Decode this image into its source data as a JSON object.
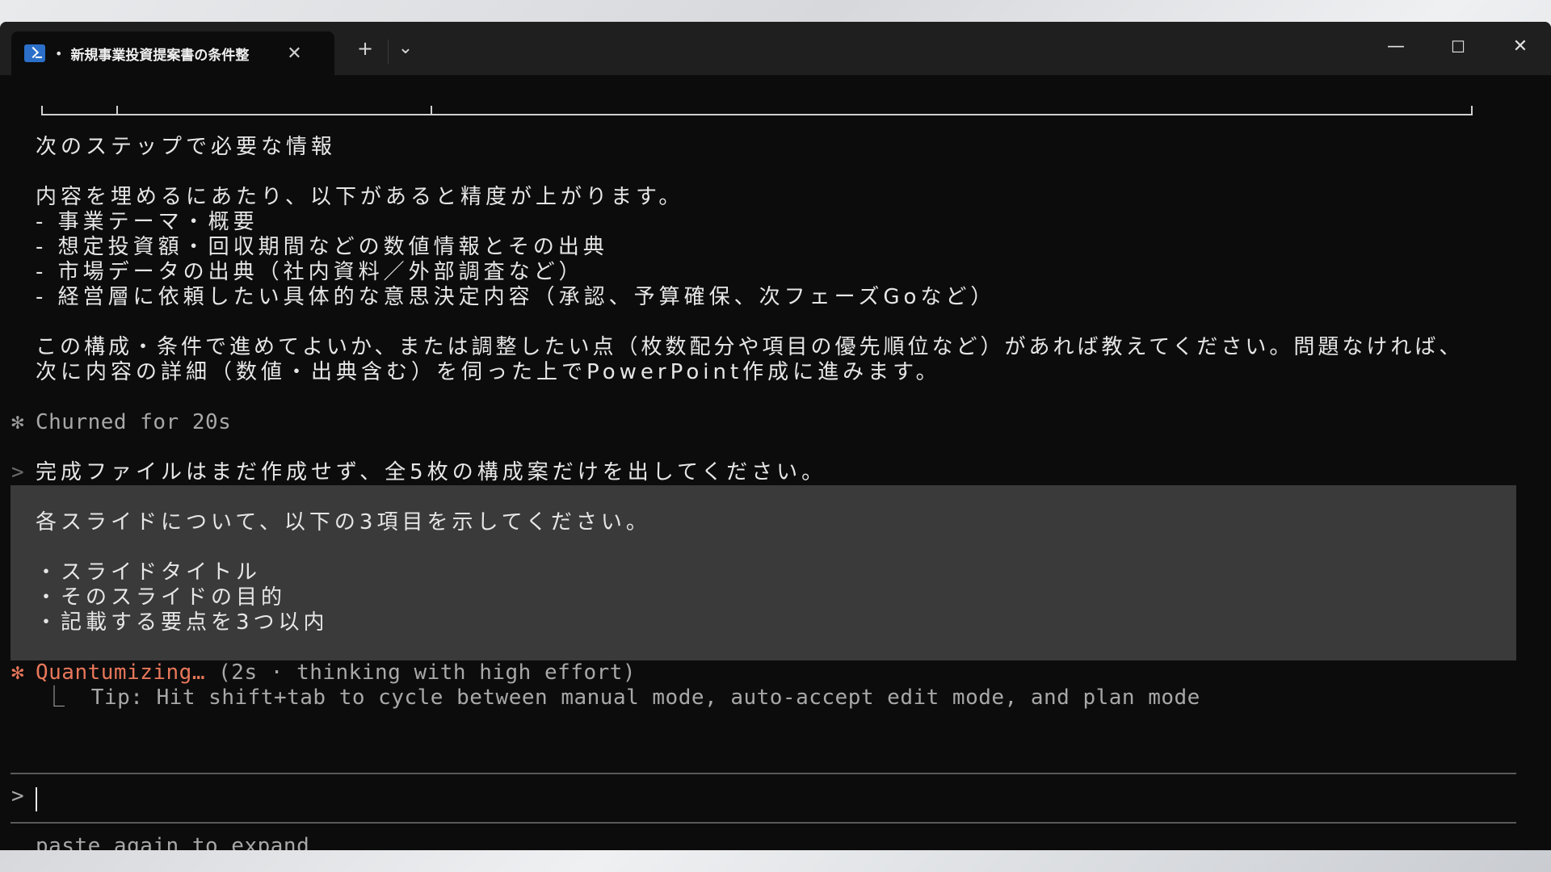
{
  "window": {
    "tab_title": "新規事業投資提案書の条件整",
    "tab_bullet": "•",
    "new_tab_label": "+",
    "dropdown_label": "⌄",
    "close_tab_label": "✕",
    "minimize_label": "—",
    "maximize_label": "☐",
    "close_label": "✕"
  },
  "terminal": {
    "section_heading": "次のステップで必要な情報",
    "intro": "内容を埋めるにあたり、以下があると精度が上がります。",
    "bullets": [
      "- 事業テーマ・概要",
      "- 想定投資額・回収期間などの数値情報とその出典",
      "- 市場データの出典（社内資料／外部調査など）",
      "- 経営層に依頼したい具体的な意思決定内容（承認、予算確保、次フェーズGoなど）"
    ],
    "closing_1": "この構成・条件で進めてよいか、または調整したい点（枚数配分や項目の優先順位など）があれば教えてください。問題なければ、",
    "closing_2": "次に内容の詳細（数値・出典含む）を伺った上でPowerPoint作成に進みます。",
    "churned_star": "✻",
    "churned_text": "Churned for 20s",
    "user_prompt_marker": ">",
    "user_lines": [
      "完成ファイルはまだ作成せず、全5枚の構成案だけを出してください。",
      "",
      "各スライドについて、以下の3項目を示してください。",
      "",
      "・スライドタイトル",
      "・そのスライドの目的",
      "・記載する要点を3つ以内"
    ],
    "status_star": "✻",
    "status_word": "Quantumizing…",
    "status_detail": " (2s · thinking with high effort)",
    "tip": "⎿  Tip: Hit shift+tab to cycle between manual mode, auto-accept edit mode, and plan mode",
    "input_prompt": ">",
    "footer_hint": "paste again to expand"
  }
}
